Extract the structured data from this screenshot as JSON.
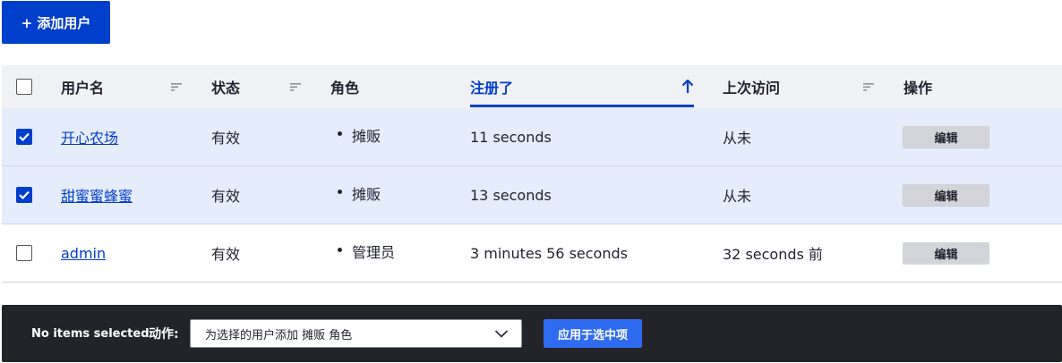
{
  "toolbar": {
    "add_user_label": "+ 添加用户"
  },
  "table": {
    "columns": {
      "username": "用户名",
      "status": "状态",
      "roles": "角色",
      "member_for": "注册了",
      "last_access": "上次访问",
      "operations": "操作"
    },
    "active_sort": "member_for",
    "sort_direction": "ascending",
    "rows": [
      {
        "checked": true,
        "username": "开心农场",
        "status": "有效",
        "role": "摊贩",
        "member_for": "11 seconds",
        "last_access": "从未",
        "edit_label": "编辑"
      },
      {
        "checked": true,
        "username": "甜蜜蜜蜂蜜",
        "status": "有效",
        "role": "摊贩",
        "member_for": "13 seconds",
        "last_access": "从未",
        "edit_label": "编辑"
      },
      {
        "checked": false,
        "username": "admin",
        "status": "有效",
        "role": "管理员",
        "member_for": "3 minutes 56 seconds",
        "last_access": "32 seconds 前",
        "edit_label": "编辑"
      }
    ]
  },
  "bulk": {
    "status": "No items selected",
    "action_label": "动作:",
    "action_selected": "为选择的用户添加 摊贩 角色",
    "apply_label": "应用于选中项"
  },
  "colors": {
    "primary": "#003ecc",
    "selected_row": "#e5ecfb",
    "header_bg": "#f0f1f5",
    "bulk_bar": "#232429"
  }
}
